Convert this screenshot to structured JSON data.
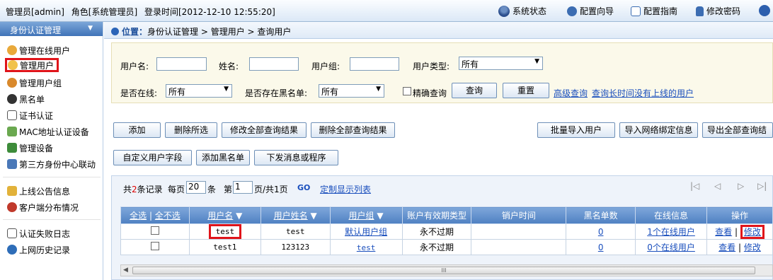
{
  "topbar": {
    "admin": "管理员[admin]",
    "role": "角色[系统管理员]",
    "login_time": "登录时间[2012-12-10 12:55:20]",
    "links": [
      "系统状态",
      "配置向导",
      "配置指南",
      "修改密码"
    ]
  },
  "sidebar": {
    "header": "身份认证管理",
    "items": [
      "管理在线用户",
      "管理用户",
      "管理用户组",
      "黑名单",
      "证书认证",
      "MAC地址认证设备",
      "管理设备",
      "第三方身份中心联动",
      "上线公告信息",
      "客户端分布情况",
      "认证失败日志",
      "上网历史记录"
    ]
  },
  "breadcrumb": {
    "position": "位置：",
    "path": "身份认证管理 > 管理用户 > 查询用户"
  },
  "search": {
    "username_label": "用户名:",
    "realname_label": "姓名:",
    "group_label": "用户组:",
    "type_label": "用户类型:",
    "type_value": "所有",
    "online_label": "是否在线:",
    "online_value": "所有",
    "blacklist_label": "是否存在黑名单:",
    "blacklist_value": "所有",
    "exact_label": "精确查询",
    "query_btn": "查询",
    "reset_btn": "重置",
    "advanced_link": "高级查询",
    "longoffline_link": "查询长时间没有上线的用户"
  },
  "actions": {
    "add": "添加",
    "delete_selected": "删除所选",
    "modify_all": "修改全部查询结果",
    "delete_all": "删除全部查询结果",
    "batch_import": "批量导入用户",
    "import_binding": "导入网络绑定信息",
    "export_all": "导出全部查询结",
    "custom_fields": "自定义用户字段",
    "add_blacklist": "添加黑名单",
    "send_msg": "下发消息或程序"
  },
  "pager": {
    "total_pre": "共",
    "total_count": "2",
    "total_post": "条记录",
    "per_page_pre": "每页",
    "per_page": "20",
    "per_page_post": "条",
    "page_pre": "第",
    "page": "1",
    "page_post": "页/共1页",
    "go": "GO",
    "custom_cols": "定制显示列表"
  },
  "table": {
    "select_all": "全选",
    "select_none": "全不选",
    "headers": [
      "用户名",
      "用户姓名",
      "用户组",
      "账户有效期类型",
      "销户时间",
      "黑名单数",
      "在线信息",
      "操作"
    ],
    "rows": [
      {
        "username": "test",
        "realname": "test",
        "group": "默认用户组",
        "expiry": "永不过期",
        "close_time": "",
        "black": "0",
        "online": "1个在线用户",
        "view": "查看",
        "edit": "修改"
      },
      {
        "username": "test1",
        "realname": "123123",
        "group": "test",
        "expiry": "永不过期",
        "close_time": "",
        "black": "0",
        "online": "0个在线用户",
        "view": "查看",
        "edit": "修改"
      }
    ],
    "sep": "|"
  },
  "scroll_label": "III"
}
